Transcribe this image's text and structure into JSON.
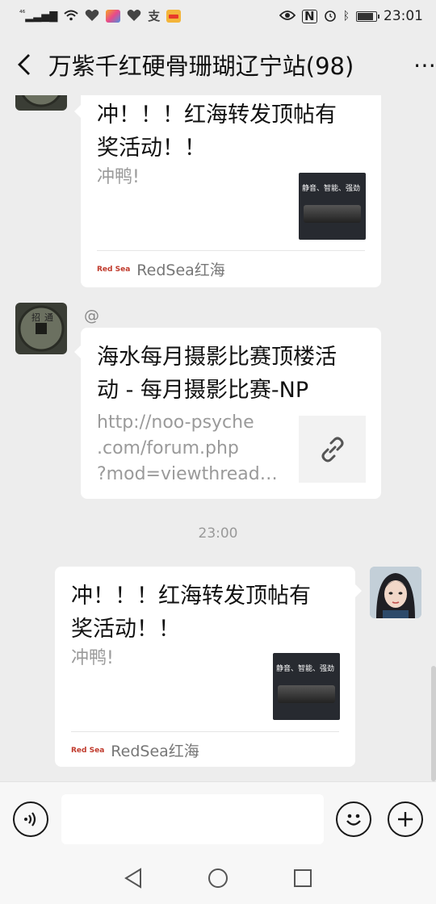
{
  "status_bar": {
    "signal": "⁴⁶",
    "time": "23:01",
    "battery_level": 0.8
  },
  "header": {
    "title": "万紫千红硬骨珊瑚辽宁站(98)",
    "more": "⋯"
  },
  "messages": [
    {
      "title_line1": "冲！！！红海转发顶帖有",
      "title_line2": "奖活动！！",
      "desc": "冲鸭!",
      "thumb_text": "静音、智能、强劲",
      "source": "RedSea红海",
      "source_logo": "Red Sea"
    },
    {
      "sender": "@",
      "title_line1": "海水每月摄影比赛顶楼活",
      "title_line2": "动 - 每月摄影比赛-NP",
      "desc_line1": "http://noo-psyche",
      "desc_line2": ".com/forum.php",
      "desc_line3": "?mod=viewthread…"
    },
    {
      "title_line1": "冲！！！红海转发顶帖有",
      "title_line2": "奖活动！！",
      "desc": "冲鸭!",
      "thumb_text": "静音、智能、强劲",
      "source": "RedSea红海",
      "source_logo": "Red Sea"
    }
  ],
  "timestamp": "23:00"
}
